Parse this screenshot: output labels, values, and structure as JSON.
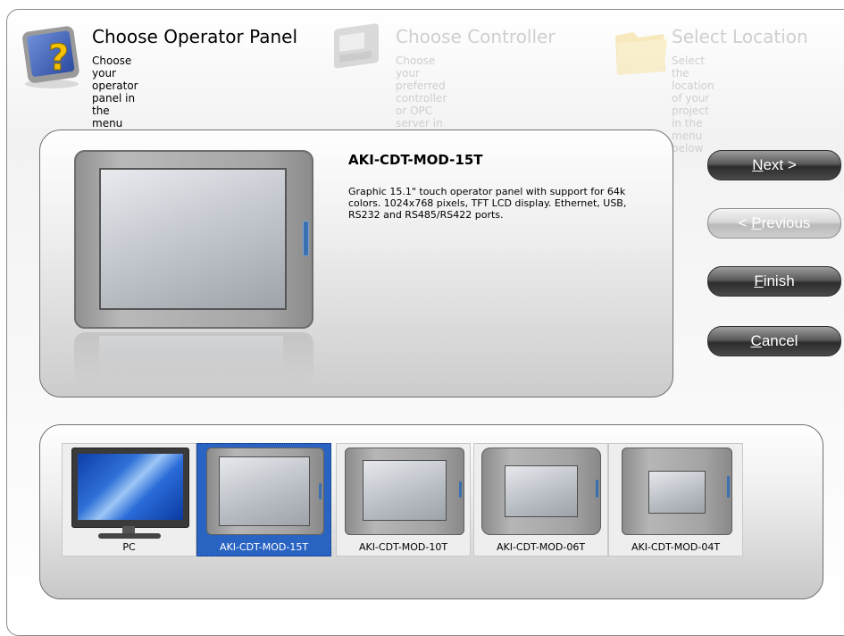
{
  "wizard": {
    "steps": [
      {
        "title": "Choose Operator Panel",
        "desc": "Choose your operator panel in the\nmenu below",
        "state": "active",
        "icon": "operator-panel-question-icon"
      },
      {
        "title": "Choose Controller",
        "desc": "Choose your preferred controller\nor OPC server in the menu below",
        "state": "inactive",
        "icon": "controller-icon"
      },
      {
        "title": "Select Location",
        "desc": "Select the location of your\nproject in the menu below",
        "state": "inactive",
        "icon": "folder-icon"
      }
    ]
  },
  "detail": {
    "name": "AKI-CDT-MOD-15T",
    "description": "Graphic 15.1\" touch operator panel with support for 64k colors. 1024x768 pixels, TFT LCD display. Ethernet, USB, RS232 and RS485/RS422 ports."
  },
  "buttons": {
    "next": {
      "mnemonic": "N",
      "rest": "ext >"
    },
    "previous": {
      "prefix": "< ",
      "mnemonic": "P",
      "rest": "revious"
    },
    "finish": {
      "mnemonic": "F",
      "rest": "inish"
    },
    "cancel": {
      "mnemonic": "C",
      "rest": "ancel"
    }
  },
  "gallery": {
    "items": [
      {
        "label": "PC",
        "selected": false
      },
      {
        "label": "AKI-CDT-MOD-15T",
        "selected": true
      },
      {
        "label": "AKI-CDT-MOD-10T",
        "selected": false
      },
      {
        "label": "AKI-CDT-MOD-06T",
        "selected": false
      },
      {
        "label": "AKI-CDT-MOD-04T",
        "selected": false
      }
    ]
  },
  "colors": {
    "selection": "#2a64c2",
    "inactive_text": "#cfcfcf",
    "led": "#3a6fb0"
  }
}
